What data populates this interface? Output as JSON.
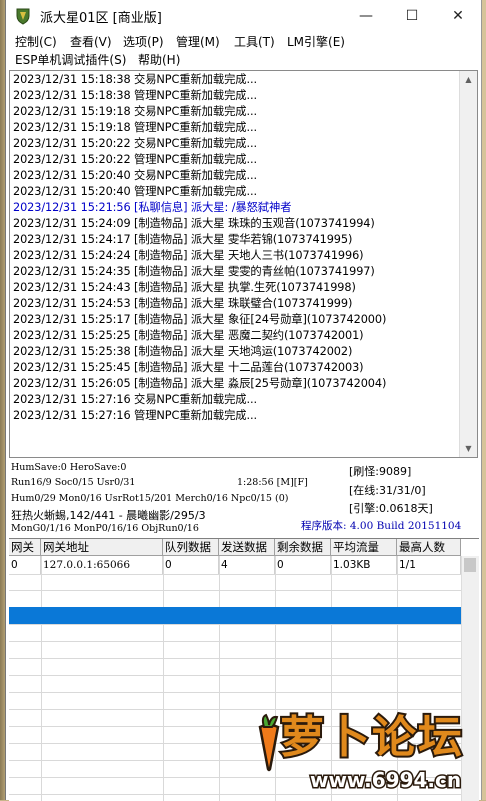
{
  "window": {
    "title": "派大星01区 [商业版]",
    "min_glyph": "—",
    "max_glyph": "☐",
    "close_glyph": "✕"
  },
  "menu": {
    "row1": [
      "控制(C)",
      "查看(V)",
      "选项(P)",
      "管理(M)",
      "工具(T)",
      "LM引擎(E)"
    ],
    "row2": [
      "ESP单机调试插件(S)",
      "帮助(H)"
    ]
  },
  "log": [
    {
      "text": "2023/12/31 15:18:38 交易NPC重新加载完成...",
      "type": "normal"
    },
    {
      "text": "2023/12/31 15:18:38 管理NPC重新加载完成...",
      "type": "normal"
    },
    {
      "text": "2023/12/31 15:19:18 交易NPC重新加载完成...",
      "type": "normal"
    },
    {
      "text": "2023/12/31 15:19:18 管理NPC重新加载完成...",
      "type": "normal"
    },
    {
      "text": "2023/12/31 15:20:22 交易NPC重新加载完成...",
      "type": "normal"
    },
    {
      "text": "2023/12/31 15:20:22 管理NPC重新加载完成...",
      "type": "normal"
    },
    {
      "text": "2023/12/31 15:20:40 交易NPC重新加载完成...",
      "type": "normal"
    },
    {
      "text": "2023/12/31 15:20:40 管理NPC重新加载完成...",
      "type": "normal"
    },
    {
      "text": "2023/12/31 15:21:56 [私聊信息] 派大星: /暴怒弑神者",
      "type": "pm"
    },
    {
      "text": "2023/12/31 15:24:09 [制造物品] 派大星 珠珠的玉观音(1073741994)",
      "type": "normal"
    },
    {
      "text": "2023/12/31 15:24:17 [制造物品] 派大星 雯华若锦(1073741995)",
      "type": "normal"
    },
    {
      "text": "2023/12/31 15:24:24 [制造物品] 派大星 天地人三书(1073741996)",
      "type": "normal"
    },
    {
      "text": "2023/12/31 15:24:35 [制造物品] 派大星 雯雯的青丝帕(1073741997)",
      "type": "normal"
    },
    {
      "text": "2023/12/31 15:24:43 [制造物品] 派大星 执掌.生死(1073741998)",
      "type": "normal"
    },
    {
      "text": "2023/12/31 15:24:53 [制造物品] 派大星 珠联璧合(1073741999)",
      "type": "normal"
    },
    {
      "text": "2023/12/31 15:25:17 [制造物品] 派大星 象征[24号勋章](1073742000)",
      "type": "normal"
    },
    {
      "text": "2023/12/31 15:25:25 [制造物品] 派大星 恶魔二契约(1073742001)",
      "type": "normal"
    },
    {
      "text": "2023/12/31 15:25:38 [制造物品] 派大星 天地鸿运(1073742002)",
      "type": "normal"
    },
    {
      "text": "2023/12/31 15:25:45 [制造物品] 派大星 十二品莲台(1073742003)",
      "type": "normal"
    },
    {
      "text": "2023/12/31 15:26:05 [制造物品] 派大星 淼辰[25号勋章](1073742004)",
      "type": "normal"
    },
    {
      "text": "2023/12/31 15:27:16 交易NPC重新加载完成...",
      "type": "normal"
    },
    {
      "text": "2023/12/31 15:27:16 管理NPC重新加载完成...",
      "type": "normal"
    }
  ],
  "status": {
    "line1": "HumSave:0 HeroSave:0",
    "line2": "Run16/9 Soc0/15 Usr0/31",
    "uptime": "1:28:56 [M][F]",
    "line3": "Hum0/29 Mon0/16 UsrRot15/201 Merch0/16 Npc0/15 (0)",
    "line4": "狂热火蜥蜴,142/441 - 晨曦幽影/295/3",
    "line5": "MonG0/1/16 MonP0/16/16 ObjRun0/16",
    "refresh_monsters": "[刷怪:9089]",
    "online": "[在线:31/31/0]",
    "engine": "[引擎:0.0618天]",
    "version": "程序版本: 4.00 Build 20151104"
  },
  "table": {
    "headers": [
      "网关",
      "网关地址",
      "队列数据",
      "发送数据",
      "剩余数据",
      "平均流量",
      "最高人数"
    ],
    "rows": [
      [
        "0",
        "127.0.0.1:65066",
        "0",
        "4",
        "0",
        "1.03KB",
        "1/1"
      ]
    ]
  },
  "watermark": {
    "text": "萝卜论坛",
    "url": "www.6994.cn"
  },
  "colors": {
    "pm_text": "#0000c8",
    "selection": "#0a78d7",
    "version_text": "#0000b0"
  }
}
